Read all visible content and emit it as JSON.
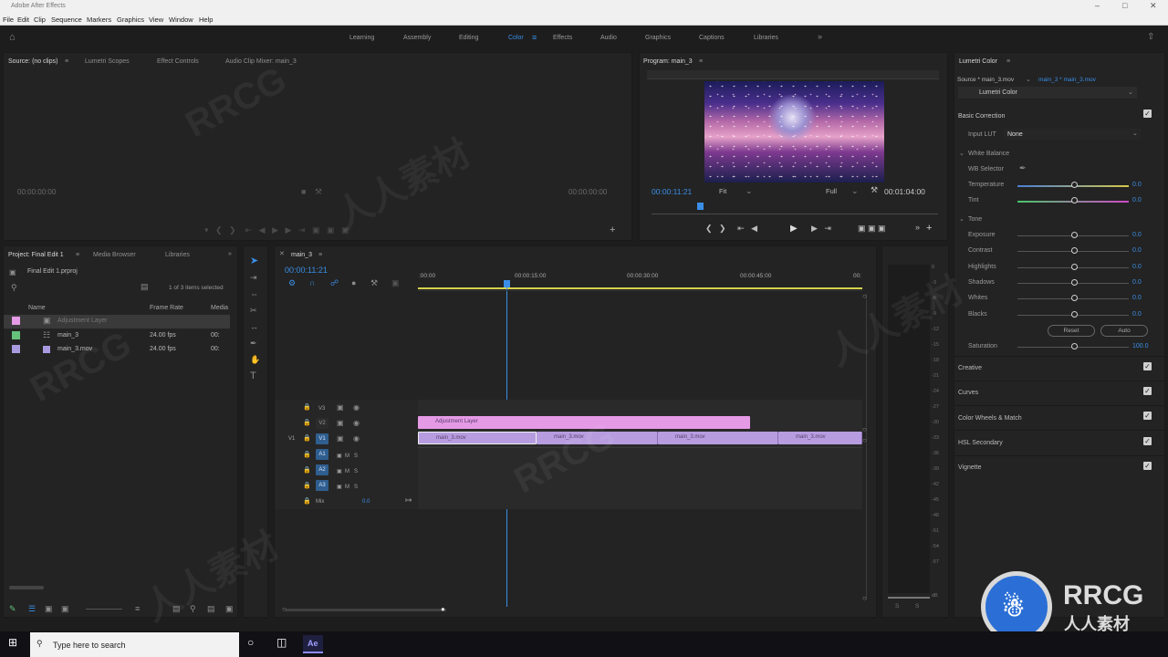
{
  "window": {
    "title": "Adobe After Effects"
  },
  "menu": [
    "File",
    "Edit",
    "Clip",
    "Sequence",
    "Markers",
    "Graphics",
    "View",
    "Window",
    "Help"
  ],
  "workspaces": [
    "Learning",
    "Assembly",
    "Editing",
    "Color",
    "Effects",
    "Audio",
    "Graphics",
    "Captions",
    "Libraries"
  ],
  "active_workspace": "Color",
  "source_panel": {
    "tabs": [
      "Source: (no clips)",
      "Lumetri Scopes",
      "Effect Controls",
      "Audio Clip Mixer: main_3"
    ],
    "timecode_left": "00:00:00:00",
    "timecode_right": "00:00:00:00"
  },
  "program_panel": {
    "tab": "Program: main_3",
    "timecode": "00:00:11:21",
    "fit": "Fit",
    "quality": "Full",
    "duration": "00:01:04:00"
  },
  "project_panel": {
    "tabs": [
      "Project: Final Edit 1",
      "Media Browser",
      "Libraries"
    ],
    "file": "Final Edit 1.prproj",
    "selection": "1 of 3 items selected",
    "columns": [
      "Name",
      "Frame Rate",
      "Media"
    ],
    "items": [
      {
        "name": "Adjustment Layer",
        "rate": "",
        "media": "",
        "color": "#e59ae6"
      },
      {
        "name": "main_3",
        "rate": "24.00 fps",
        "media": "00:",
        "color": "#66c27b"
      },
      {
        "name": "main_3.mov",
        "rate": "24.00 fps",
        "media": "00:",
        "color": "#a99ae0"
      }
    ]
  },
  "timeline": {
    "tab": "main_3",
    "timecode": "00:00:11:21",
    "ruler": [
      ":00:00",
      "00:00:15:00",
      "00:00:30:00",
      "00:00:45:00",
      "00:"
    ],
    "video_tracks": [
      "V3",
      "V2",
      "V1"
    ],
    "audio_tracks": [
      "A1",
      "A2",
      "A3"
    ],
    "mix_label": "Mix",
    "mix_value": "0.0",
    "clips": {
      "adjustment": "Adjustment Layer",
      "v1": [
        "main_3.mov",
        "main_3.mov",
        "main_3.mov",
        "main_3.mov"
      ]
    }
  },
  "audio_meter": {
    "ticks": [
      "0",
      "-3",
      "-6",
      "-9",
      "-12",
      "-15",
      "-18",
      "-21",
      "-24",
      "-27",
      "-30",
      "-33",
      "-36",
      "-39",
      "-42",
      "-45",
      "-48",
      "-51",
      "-54",
      "-57",
      "dB"
    ],
    "solo": [
      "S",
      "S"
    ]
  },
  "lumetri": {
    "tab": "Lumetri Color",
    "source": "Source * main_3.mov",
    "target": "main_3 * main_3.mov",
    "effect": "Lumetri Color",
    "basic_correction": "Basic Correction",
    "input_lut_label": "Input LUT",
    "input_lut_value": "None",
    "white_balance": "White Balance",
    "wb_selector": "WB Selector",
    "tone": "Tone",
    "sliders": [
      {
        "label": "Temperature",
        "value": "0.0"
      },
      {
        "label": "Tint",
        "value": "0.0"
      },
      {
        "label": "Exposure",
        "value": "0.0"
      },
      {
        "label": "Contrast",
        "value": "0.0"
      },
      {
        "label": "Highlights",
        "value": "0.0"
      },
      {
        "label": "Shadows",
        "value": "0.0"
      },
      {
        "label": "Whites",
        "value": "0.0"
      },
      {
        "label": "Blacks",
        "value": "0.0"
      }
    ],
    "reset": "Reset",
    "auto": "Auto",
    "saturation_label": "Saturation",
    "saturation_value": "100.0",
    "sections": [
      "Creative",
      "Curves",
      "Color Wheels & Match",
      "HSL Secondary",
      "Vignette"
    ]
  },
  "taskbar": {
    "search_placeholder": "Type here to search",
    "app": "Ae"
  },
  "watermark": {
    "text_latin": "RRCG",
    "text_cjk": "人人素材"
  }
}
